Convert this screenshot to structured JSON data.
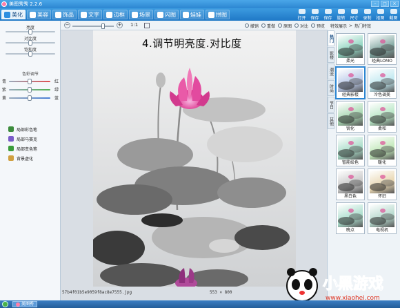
{
  "window": {
    "title": "美图秀秀 2.2.6"
  },
  "tabs": [
    {
      "label": "美化",
      "icon": "beautify-icon",
      "active": true
    },
    {
      "label": "美容",
      "icon": "makeup-icon",
      "active": false
    },
    {
      "label": "饰品",
      "icon": "accessory-icon",
      "active": false
    },
    {
      "label": "文字",
      "icon": "text-icon",
      "active": false
    },
    {
      "label": "边框",
      "icon": "frame-icon",
      "active": false
    },
    {
      "label": "场景",
      "icon": "scene-icon",
      "active": false
    },
    {
      "label": "闪图",
      "icon": "flash-icon",
      "active": false
    },
    {
      "label": "娃娃",
      "icon": "doll-icon",
      "active": false
    },
    {
      "label": "拼图",
      "icon": "puzzle-icon",
      "active": false
    }
  ],
  "actions": [
    {
      "label": "打开",
      "icon": "open-icon"
    },
    {
      "label": "保存",
      "icon": "save-icon"
    },
    {
      "label": "保存",
      "icon": "save-as-icon"
    },
    {
      "label": "旋转",
      "icon": "rotate-icon"
    },
    {
      "label": "尺寸",
      "icon": "resize-icon"
    },
    {
      "label": "录制",
      "icon": "record-icon"
    },
    {
      "label": "抠图",
      "icon": "cutout-icon"
    },
    {
      "label": "截图",
      "icon": "screenshot-icon"
    }
  ],
  "adjust": {
    "brightness": {
      "label": "亮度",
      "value": 0.5
    },
    "contrast": {
      "label": "对比度",
      "value": 0.5
    },
    "saturation": {
      "label": "饱和度",
      "value": 0.5
    }
  },
  "color_adjust": {
    "title": "色彩调节",
    "rows": [
      {
        "left": "青",
        "right": "红",
        "value": 0.5,
        "color": "#e05050"
      },
      {
        "left": "紫",
        "right": "绿",
        "value": 0.5,
        "color": "#50b050"
      },
      {
        "left": "黄",
        "right": "蓝",
        "value": 0.5,
        "color": "#4a7fd6"
      }
    ]
  },
  "tools": [
    {
      "label": "局部彩色笔",
      "icon": "color-pen-icon",
      "color": "#3c8c3c"
    },
    {
      "label": "局部马赛克",
      "icon": "mosaic-icon",
      "color": "#7a5cc8"
    },
    {
      "label": "局部变色笔",
      "icon": "recolor-pen-icon",
      "color": "#3a9c3a"
    },
    {
      "label": "背景虚化",
      "icon": "blur-icon",
      "color": "#d0a040"
    }
  ],
  "canvas": {
    "ratio": "1:1",
    "actions": [
      {
        "label": "撤销",
        "icon": "undo-icon"
      },
      {
        "label": "重做",
        "icon": "redo-icon"
      },
      {
        "label": "原图",
        "icon": "original-icon"
      },
      {
        "label": "对比",
        "icon": "compare-icon"
      },
      {
        "label": "预览",
        "icon": "preview-icon"
      }
    ],
    "caption": "4.调节明亮度.对比度",
    "filename": "57b4f01b5e9059f8ac8e7555.jpg",
    "dimensions": "553 × 800",
    "zoom": 0.7
  },
  "effects": {
    "breadcrumb": [
      "特效展示",
      "热门特效"
    ],
    "categories": [
      "热门",
      "影楼",
      "潮流",
      "时尚",
      "节日",
      "其他"
    ],
    "active_category": 0,
    "items": [
      {
        "label": "柔光",
        "tint": "#8fd4c0"
      },
      {
        "label": "经典LOMO",
        "tint": "#7fa6a0"
      },
      {
        "label": "经典影楼",
        "tint": "#b8c8e8"
      },
      {
        "label": "冷色调美",
        "tint": "#bfe8f0"
      },
      {
        "label": "锐化",
        "tint": "#a6d6b0"
      },
      {
        "label": "柔和",
        "tint": "#b6e6c4"
      },
      {
        "label": "智能绘色",
        "tint": "#a8dcc8"
      },
      {
        "label": "暖化",
        "tint": "#c0e8b8"
      },
      {
        "label": "黑白色",
        "tint": "#c8c8c8"
      },
      {
        "label": "怀旧",
        "tint": "#e8d6b0"
      },
      {
        "label": "晚点",
        "tint": "#aaddcc"
      },
      {
        "label": "电视机",
        "tint": "#b4d8cc"
      }
    ]
  },
  "watermark": {
    "text": "小黑游戏",
    "url": "www.xiaohei.com"
  },
  "taskbar": {
    "item": "美图秀"
  }
}
